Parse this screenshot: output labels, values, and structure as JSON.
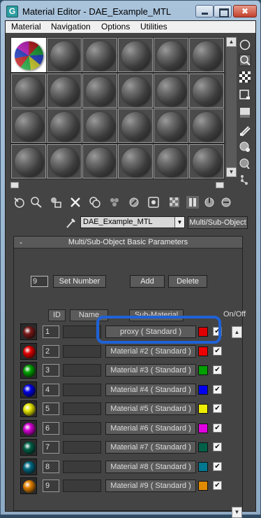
{
  "window": {
    "title": "Material Editor - DAE_Example_MTL",
    "app_icon": "G"
  },
  "menu": [
    "Material",
    "Navigation",
    "Options",
    "Utilities"
  ],
  "slot_grid": {
    "rows": 4,
    "cols": 6,
    "active_index": 0
  },
  "material": {
    "name": "DAE_Example_MTL",
    "type_button": "Multi/Sub-Object",
    "dropdown_arrow": "▼"
  },
  "rollout": {
    "collapse": "-",
    "title": "Multi/Sub-Object Basic Parameters",
    "count": "9",
    "set_number": "Set Number",
    "add": "Add",
    "delete": "Delete",
    "columns": {
      "id": "ID",
      "name": "Name",
      "sub_material": "Sub-Material",
      "on_off": "On/Off"
    }
  },
  "rows": [
    {
      "id": "1",
      "material": "proxy  ( Standard )",
      "color": "#e00000",
      "ball": "#7a1a1a",
      "checked": "✔"
    },
    {
      "id": "2",
      "material": "Material #2  ( Standard )",
      "color": "#ee0000",
      "ball": "#e00000",
      "checked": "✔"
    },
    {
      "id": "3",
      "material": "Material #3  ( Standard )",
      "color": "#00a000",
      "ball": "#00a000",
      "checked": "✔"
    },
    {
      "id": "4",
      "material": "Material #4  ( Standard )",
      "color": "#0000ee",
      "ball": "#0000e0",
      "checked": "✔"
    },
    {
      "id": "5",
      "material": "Material #5  ( Standard )",
      "color": "#eeee00",
      "ball": "#e6e600",
      "checked": "✔"
    },
    {
      "id": "6",
      "material": "Material #6  ( Standard )",
      "color": "#e000e0",
      "ball": "#d000d0",
      "checked": "✔"
    },
    {
      "id": "7",
      "material": "Material #7  ( Standard )",
      "color": "#00604a",
      "ball": "#006048",
      "checked": "✔"
    },
    {
      "id": "8",
      "material": "Material #8  ( Standard )",
      "color": "#007890",
      "ball": "#006880",
      "checked": "✔"
    },
    {
      "id": "9",
      "material": "Material #9  ( Standard )",
      "color": "#e08a00",
      "ball": "#e08000",
      "checked": "✔"
    }
  ],
  "scroll": {
    "up": "▲",
    "down": "▼"
  }
}
